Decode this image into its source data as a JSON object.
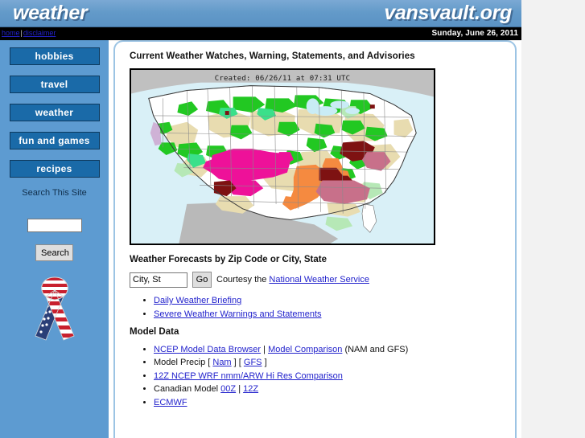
{
  "banner": {
    "left_title": "weather",
    "right_title": "vansvault.org"
  },
  "nav": {
    "home_label": "home",
    "separator": "|",
    "disclaimer_label": "disclaimer",
    "date": "Sunday, June 26, 2011"
  },
  "sidebar": {
    "buttons": [
      {
        "label": "hobbies"
      },
      {
        "label": "travel"
      },
      {
        "label": "weather"
      },
      {
        "label": "fun and games"
      },
      {
        "label": "recipes"
      }
    ],
    "search_heading": "Search This Site",
    "search_value": "",
    "search_placeholder": "",
    "search_button_label": "Search",
    "ribbon_icon": "american-flag-ribbon-icon"
  },
  "main": {
    "watches_heading": "Current Weather Watches, Warning, Statements, and Advisories",
    "map": {
      "created_text": "Created: 06/26/11 at 07:31 UTC",
      "alt": "US weather watches warnings and advisories map"
    },
    "forecast": {
      "heading": "Weather Forecasts by Zip Code or City, State",
      "input_value": "City, St",
      "input_placeholder": "City, St",
      "go_label": "Go",
      "courtesy_prefix": "Courtesy the ",
      "courtesy_link": "National Weather Service"
    },
    "quick_links": [
      {
        "label": "Daily Weather Briefing"
      },
      {
        "label": "Severe Weather Warnings and Statements"
      }
    ],
    "model_data": {
      "heading": "Model Data",
      "items": [
        {
          "parts": [
            {
              "text": "NCEP Model Data Browser",
              "link": true
            },
            {
              "text": " | ",
              "link": false
            },
            {
              "text": "Model Comparison",
              "link": true
            },
            {
              "text": " (NAM and GFS)",
              "link": false
            }
          ]
        },
        {
          "parts": [
            {
              "text": "Model Precip [ ",
              "link": false
            },
            {
              "text": "Nam",
              "link": true
            },
            {
              "text": " ] [ ",
              "link": false
            },
            {
              "text": "GFS",
              "link": true
            },
            {
              "text": " ]",
              "link": false
            }
          ]
        },
        {
          "parts": [
            {
              "text": "12Z NCEP WRF nmm/ARW Hi Res Comparison",
              "link": true
            }
          ]
        },
        {
          "parts": [
            {
              "text": "Canadian Model ",
              "link": false
            },
            {
              "text": "00Z",
              "link": true
            },
            {
              "text": " | ",
              "link": false
            },
            {
              "text": "12Z",
              "link": true
            }
          ]
        },
        {
          "parts": [
            {
              "text": "ECMWF",
              "link": true
            }
          ]
        }
      ]
    }
  },
  "colors": {
    "banner_blue": "#639ac9",
    "sidebar_blue": "#5d9bd1",
    "button_blue": "#1a6aa8",
    "link_blue": "#2222cc",
    "card_border": "#9cc4e4",
    "navbar_black": "#000000"
  }
}
